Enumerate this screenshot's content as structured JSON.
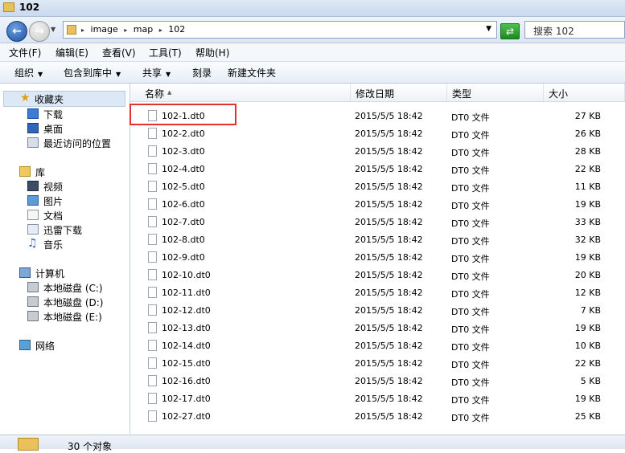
{
  "window": {
    "title": "102"
  },
  "address": {
    "crumbs": [
      "image",
      "map",
      "102"
    ],
    "search_placeholder": "搜索 102"
  },
  "menu": [
    "文件(F)",
    "编辑(E)",
    "查看(V)",
    "工具(T)",
    "帮助(H)"
  ],
  "toolbar": {
    "organize": "组织",
    "include_library": "包含到库中",
    "share": "共享",
    "burn": "刻录",
    "new_folder": "新建文件夹"
  },
  "nav": {
    "favorites": "收藏夹",
    "downloads": "下载",
    "desktop": "桌面",
    "recent": "最近访问的位置",
    "libraries": "库",
    "videos": "视频",
    "pictures": "图片",
    "documents": "文档",
    "thunder": "迅雷下载",
    "music": "音乐",
    "computer": "计算机",
    "disk_c": "本地磁盘 (C:)",
    "disk_d": "本地磁盘 (D:)",
    "disk_e": "本地磁盘 (E:)",
    "network": "网络"
  },
  "columns": {
    "name": "名称",
    "date": "修改日期",
    "type": "类型",
    "size": "大小"
  },
  "files": [
    {
      "name": "102-1.dt0",
      "date": "2015/5/5 18:42",
      "type": "DT0 文件",
      "size": "27 KB"
    },
    {
      "name": "102-2.dt0",
      "date": "2015/5/5 18:42",
      "type": "DT0 文件",
      "size": "26 KB"
    },
    {
      "name": "102-3.dt0",
      "date": "2015/5/5 18:42",
      "type": "DT0 文件",
      "size": "28 KB"
    },
    {
      "name": "102-4.dt0",
      "date": "2015/5/5 18:42",
      "type": "DT0 文件",
      "size": "22 KB"
    },
    {
      "name": "102-5.dt0",
      "date": "2015/5/5 18:42",
      "type": "DT0 文件",
      "size": "11 KB"
    },
    {
      "name": "102-6.dt0",
      "date": "2015/5/5 18:42",
      "type": "DT0 文件",
      "size": "19 KB"
    },
    {
      "name": "102-7.dt0",
      "date": "2015/5/5 18:42",
      "type": "DT0 文件",
      "size": "33 KB"
    },
    {
      "name": "102-8.dt0",
      "date": "2015/5/5 18:42",
      "type": "DT0 文件",
      "size": "32 KB"
    },
    {
      "name": "102-9.dt0",
      "date": "2015/5/5 18:42",
      "type": "DT0 文件",
      "size": "19 KB"
    },
    {
      "name": "102-10.dt0",
      "date": "2015/5/5 18:42",
      "type": "DT0 文件",
      "size": "20 KB"
    },
    {
      "name": "102-11.dt0",
      "date": "2015/5/5 18:42",
      "type": "DT0 文件",
      "size": "12 KB"
    },
    {
      "name": "102-12.dt0",
      "date": "2015/5/5 18:42",
      "type": "DT0 文件",
      "size": "7 KB"
    },
    {
      "name": "102-13.dt0",
      "date": "2015/5/5 18:42",
      "type": "DT0 文件",
      "size": "19 KB"
    },
    {
      "name": "102-14.dt0",
      "date": "2015/5/5 18:42",
      "type": "DT0 文件",
      "size": "10 KB"
    },
    {
      "name": "102-15.dt0",
      "date": "2015/5/5 18:42",
      "type": "DT0 文件",
      "size": "22 KB"
    },
    {
      "name": "102-16.dt0",
      "date": "2015/5/5 18:42",
      "type": "DT0 文件",
      "size": "5 KB"
    },
    {
      "name": "102-17.dt0",
      "date": "2015/5/5 18:42",
      "type": "DT0 文件",
      "size": "19 KB"
    },
    {
      "name": "102-27.dt0",
      "date": "2015/5/5 18:42",
      "type": "DT0 文件",
      "size": "25 KB"
    }
  ],
  "status": {
    "count_text": "30 个对象"
  }
}
